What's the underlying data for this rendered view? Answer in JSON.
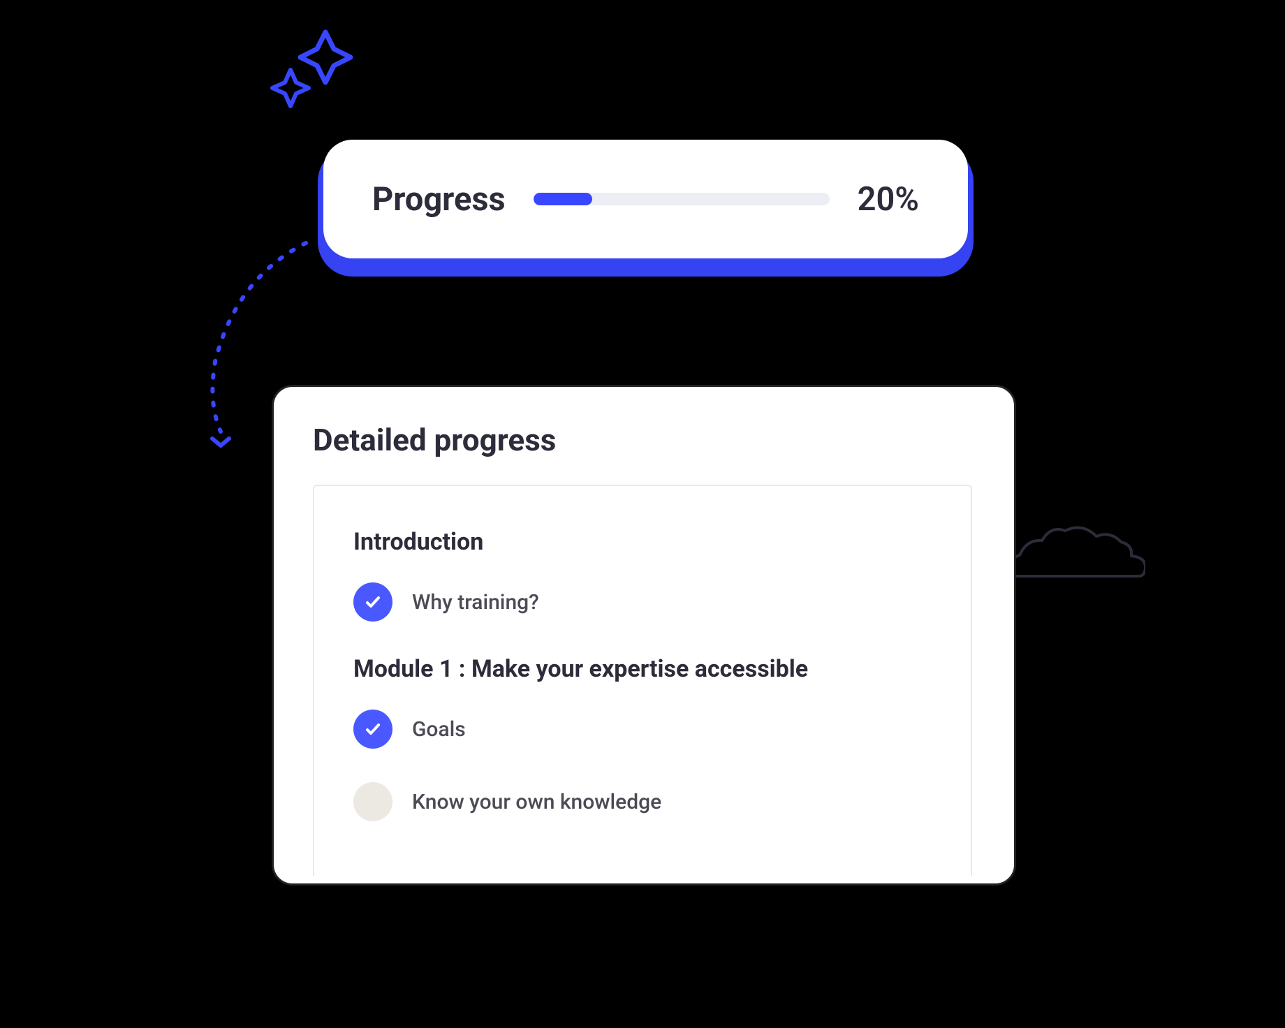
{
  "colors": {
    "accent": "#3847ff",
    "text_dark": "#2c2c3a",
    "text_muted": "#4b4b56",
    "check_bg_done": "#4959ff",
    "check_bg_pending": "#ece9e3"
  },
  "progress": {
    "label": "Progress",
    "percent": 20,
    "percent_label": "20%"
  },
  "detail": {
    "title": "Detailed progress",
    "sections": [
      {
        "title": "Introduction",
        "items": [
          {
            "label": "Why training?",
            "done": true
          }
        ]
      },
      {
        "title": "Module 1 : Make your expertise accessible",
        "items": [
          {
            "label": "Goals",
            "done": true
          },
          {
            "label": "Know your own knowledge",
            "done": false
          }
        ]
      }
    ]
  }
}
